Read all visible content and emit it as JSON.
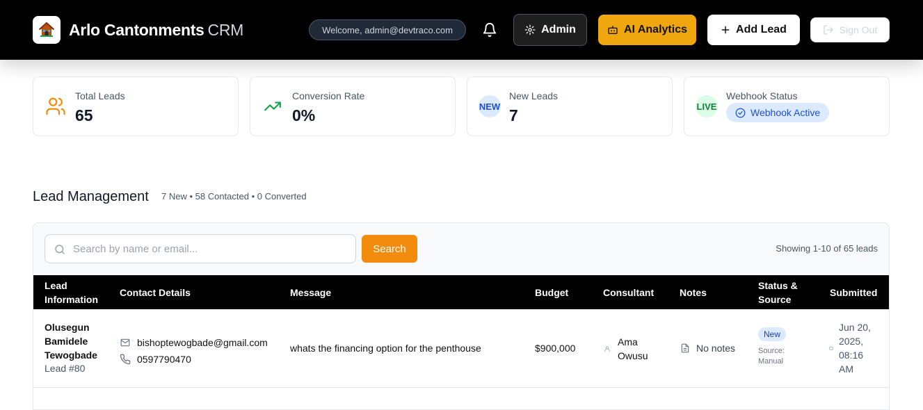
{
  "header": {
    "brand_name": "Arlo Cantonments",
    "brand_suffix": "CRM",
    "welcome": "Welcome, admin@devtraco.com",
    "admin_label": "Admin",
    "ai_label": "AI Analytics",
    "add_lead_label": "Add Lead",
    "sign_out_label": "Sign Out",
    "colors": {
      "bar": "#000000",
      "ai": "#f0a70f"
    }
  },
  "stats": {
    "total_leads": {
      "label": "Total Leads",
      "value": "65"
    },
    "conversion": {
      "label": "Conversion Rate",
      "value": "0%"
    },
    "new_leads": {
      "label": "New Leads",
      "value": "7",
      "badge": "NEW"
    },
    "webhook": {
      "label": "Webhook Status",
      "badge": "LIVE",
      "status": "Webhook Active"
    }
  },
  "section": {
    "title": "Lead Management",
    "summary": "7 New • 58 Contacted • 0 Converted"
  },
  "search": {
    "placeholder": "Search by name or email...",
    "value": "",
    "button": "Search",
    "showing": "Showing 1-10 of 65 leads"
  },
  "table": {
    "headers": {
      "lead_line1": "Lead",
      "lead_line2": "Information",
      "contact": "Contact Details",
      "message": "Message",
      "budget": "Budget",
      "consultant": "Consultant",
      "notes": "Notes",
      "status_line1": "Status &",
      "status_line2": "Source",
      "submitted": "Submitted"
    },
    "rows": [
      {
        "name_1": "Olusegun",
        "name_2": "Bamidele",
        "name_3": "Tewogbade",
        "lead_id": "Lead #80",
        "email": "bishoptewogbade@gmail.com",
        "phone": "0597790470",
        "message": "whats the financing option for the penthouse",
        "budget": "$900,000",
        "consultant_1": "Ama",
        "consultant_2": "Owusu",
        "notes": "No notes",
        "status": "New",
        "source_1": "Source:",
        "source_2": "Manual",
        "date_1": "Jun 20,",
        "date_2": "2025,",
        "date_3": "08:16",
        "date_4": "AM"
      }
    ]
  }
}
